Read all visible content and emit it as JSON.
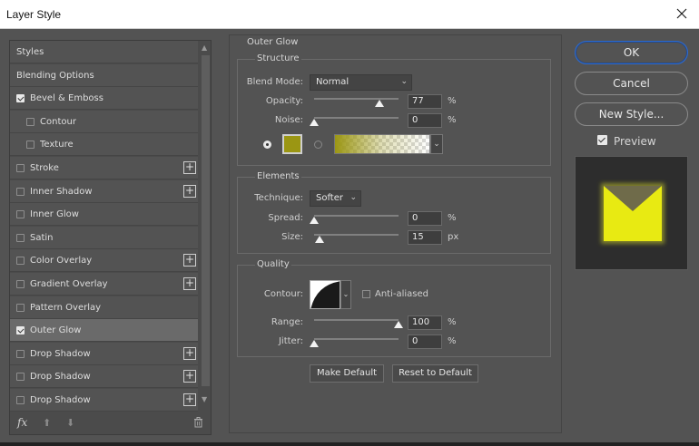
{
  "window": {
    "title": "Layer Style"
  },
  "styles_panel": {
    "items": [
      {
        "label": "Styles",
        "checkbox": false,
        "checked": false,
        "plus": false,
        "indent": 0,
        "selected": false
      },
      {
        "label": "Blending Options",
        "checkbox": false,
        "checked": false,
        "plus": false,
        "indent": 0,
        "selected": false
      },
      {
        "label": "Bevel & Emboss",
        "checkbox": true,
        "checked": true,
        "plus": false,
        "indent": 0,
        "selected": false
      },
      {
        "label": "Contour",
        "checkbox": true,
        "checked": false,
        "plus": false,
        "indent": 1,
        "selected": false
      },
      {
        "label": "Texture",
        "checkbox": true,
        "checked": false,
        "plus": false,
        "indent": 1,
        "selected": false
      },
      {
        "label": "Stroke",
        "checkbox": true,
        "checked": false,
        "plus": true,
        "indent": 0,
        "selected": false
      },
      {
        "label": "Inner Shadow",
        "checkbox": true,
        "checked": false,
        "plus": true,
        "indent": 0,
        "selected": false
      },
      {
        "label": "Inner Glow",
        "checkbox": true,
        "checked": false,
        "plus": false,
        "indent": 0,
        "selected": false
      },
      {
        "label": "Satin",
        "checkbox": true,
        "checked": false,
        "plus": false,
        "indent": 0,
        "selected": false
      },
      {
        "label": "Color Overlay",
        "checkbox": true,
        "checked": false,
        "plus": true,
        "indent": 0,
        "selected": false
      },
      {
        "label": "Gradient Overlay",
        "checkbox": true,
        "checked": false,
        "plus": true,
        "indent": 0,
        "selected": false
      },
      {
        "label": "Pattern Overlay",
        "checkbox": true,
        "checked": false,
        "plus": false,
        "indent": 0,
        "selected": false
      },
      {
        "label": "Outer Glow",
        "checkbox": true,
        "checked": true,
        "plus": false,
        "indent": 0,
        "selected": true
      },
      {
        "label": "Drop Shadow",
        "checkbox": true,
        "checked": false,
        "plus": true,
        "indent": 0,
        "selected": false
      },
      {
        "label": "Drop Shadow",
        "checkbox": true,
        "checked": false,
        "plus": true,
        "indent": 0,
        "selected": false
      },
      {
        "label": "Drop Shadow",
        "checkbox": true,
        "checked": false,
        "plus": true,
        "indent": 0,
        "selected": false
      }
    ],
    "footer": {
      "fx_label": "fx",
      "icons": [
        "move-up-icon",
        "move-down-icon",
        "trash-icon"
      ]
    }
  },
  "outer_glow": {
    "title": "Outer Glow",
    "structure": {
      "title": "Structure",
      "blend_mode_label": "Blend Mode:",
      "blend_mode_value": "Normal",
      "opacity_label": "Opacity:",
      "opacity_value": "77",
      "opacity_unit": "%",
      "opacity_level": 0.77,
      "noise_label": "Noise:",
      "noise_value": "0",
      "noise_unit": "%",
      "noise_level": 0,
      "glow_color": "#9b9613"
    },
    "elements": {
      "title": "Elements",
      "technique_label": "Technique:",
      "technique_value": "Softer",
      "spread_label": "Spread:",
      "spread_value": "0",
      "spread_unit": "%",
      "spread_level": 0,
      "size_label": "Size:",
      "size_value": "15",
      "size_unit": "px",
      "size_level": 0.06
    },
    "quality": {
      "title": "Quality",
      "contour_label": "Contour:",
      "anti_aliased_label": "Anti-aliased",
      "anti_aliased": false,
      "range_label": "Range:",
      "range_value": "100",
      "range_unit": "%",
      "range_level": 1,
      "jitter_label": "Jitter:",
      "jitter_value": "0",
      "jitter_unit": "%",
      "jitter_level": 0
    },
    "make_default_label": "Make Default",
    "reset_default_label": "Reset to Default"
  },
  "actions": {
    "ok_label": "OK",
    "cancel_label": "Cancel",
    "new_style_label": "New Style...",
    "preview_label": "Preview",
    "preview_checked": true
  },
  "colors": {
    "accent": "#2d6bd0",
    "preview_fill": "#e8ea12",
    "preview_glow": "#7b7a3e"
  }
}
